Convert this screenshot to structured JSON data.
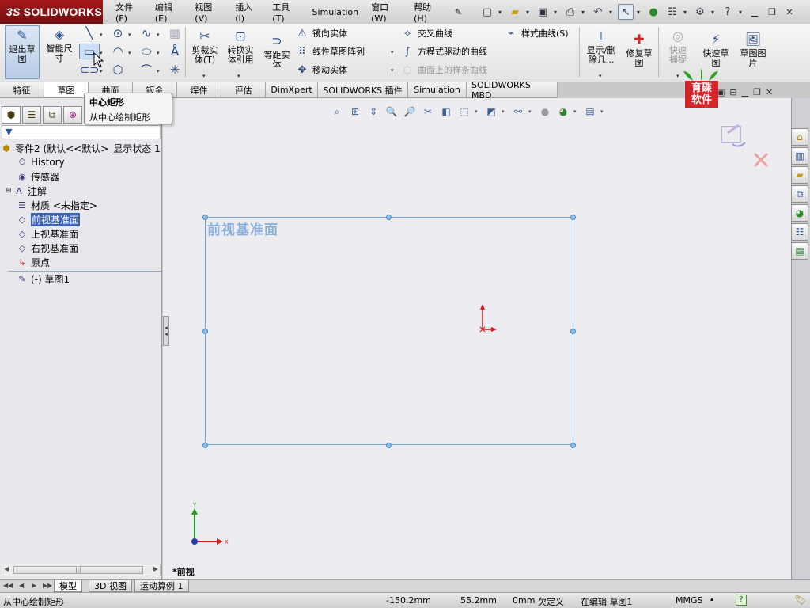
{
  "app": {
    "logo_text": "SOLIDWORKS",
    "logo_prefix": "3S"
  },
  "menu": [
    "文件(F)",
    "编辑(E)",
    "视图(V)",
    "插入(I)",
    "工具(T)",
    "Simulation",
    "窗口(W)",
    "帮助(H)"
  ],
  "ribbon": {
    "exit_sketch": "退出草图",
    "smart_dim": "智能尺寸",
    "trim": "剪裁实体(T)",
    "convert": "转换实体引用",
    "offset": "等距实体",
    "mirror": "镜向实体",
    "linear_pattern": "线性草图阵列",
    "move": "移动实体",
    "intersect_curve": "交叉曲线",
    "equation_curve": "方程式驱动的曲线",
    "spline_on_surface": "曲面上的样条曲线",
    "style_spline": "样式曲线(S)",
    "display_delete": "显示/删除几...",
    "repair_sketch": "修复草图",
    "quick_snap": "快速捕捉",
    "rapid_sketch": "快速草图",
    "sketch_picture": "草图图片"
  },
  "tabs": [
    "特征",
    "草图",
    "曲面",
    "钣金",
    "焊件",
    "评估",
    "DimXpert",
    "SOLIDWORKS 插件",
    "Simulation",
    "SOLIDWORKS MBD"
  ],
  "active_tab": 1,
  "tooltip": {
    "title": "中心矩形",
    "desc": "从中心绘制矩形"
  },
  "tree": {
    "root": "零件2  (默认<<默认>_显示状态 1",
    "items": [
      {
        "label": "History",
        "icon": "history-icon"
      },
      {
        "label": "传感器",
        "icon": "sensor-icon"
      },
      {
        "label": "注解",
        "icon": "annotation-icon"
      },
      {
        "label": "材质 <未指定>",
        "icon": "material-icon"
      },
      {
        "label": "前视基准面",
        "icon": "plane-icon",
        "selected": true
      },
      {
        "label": "上视基准面",
        "icon": "plane-icon"
      },
      {
        "label": "右视基准面",
        "icon": "plane-icon"
      },
      {
        "label": "原点",
        "icon": "origin-icon"
      }
    ],
    "sketch": "(-) 草图1"
  },
  "graphics": {
    "plane_label": "前视基准面",
    "view_label": "*前视",
    "triad_x": "X",
    "triad_y": "Y"
  },
  "watermark": {
    "line1": "育碟",
    "line2": "软件"
  },
  "model_tabs": [
    "模型",
    "3D 视图",
    "运动算例 1"
  ],
  "status": {
    "message": "从中心绘制矩形",
    "x": "-150.2mm",
    "y": "55.2mm",
    "z": "0mm",
    "state": "欠定义",
    "editing": "在编辑 草图1",
    "units": "MMGS",
    "help": "?"
  },
  "colors": {
    "plane_edge": "#6fa5df",
    "plane_label": "#8ab0dc",
    "selection": "#3a63b8",
    "watermark": "#d5252b",
    "origin": "#d8161c"
  }
}
